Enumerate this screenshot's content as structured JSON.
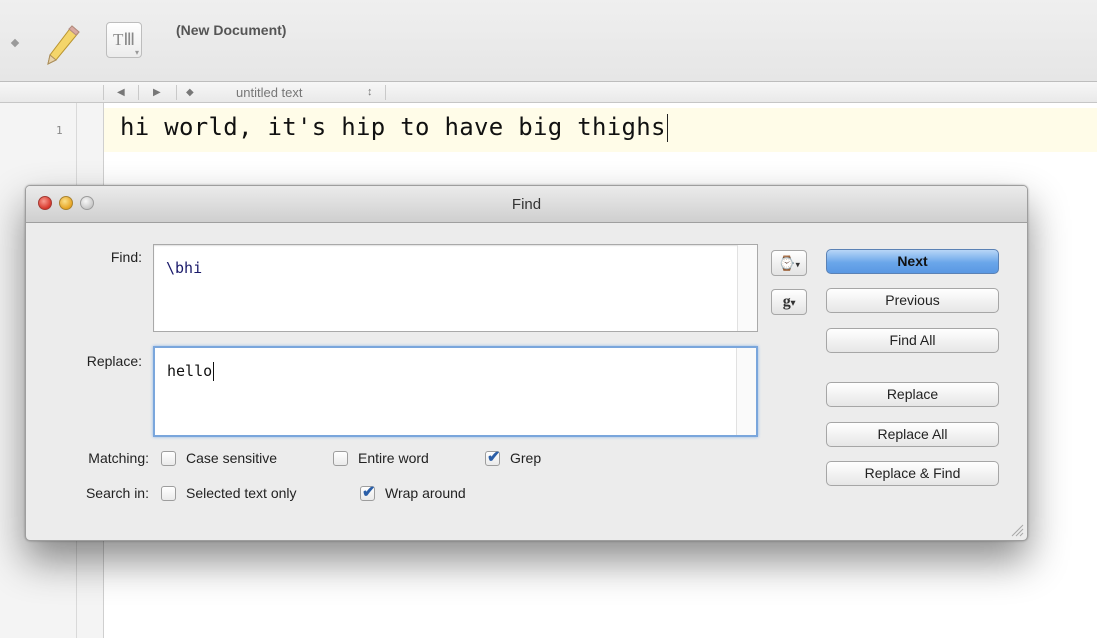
{
  "editor": {
    "document_title": "(New Document)",
    "text_button_glyph": "TⅢ",
    "nav": {
      "back_glyph": "◀",
      "forward_glyph": "▶",
      "marker_glyph": "◆",
      "file_name": "untitled text",
      "stepper_glyph": "↕"
    },
    "line_number": "1",
    "line_text": "hi world, it's hip to have big thighs"
  },
  "find_dialog": {
    "title": "Find",
    "find_label": "Find:",
    "find_value": "\\bhi",
    "replace_label": "Replace:",
    "replace_value": "hello",
    "history_glyph": "⌚",
    "grep_glyph": "g",
    "dropdown_glyph": "▾",
    "buttons": {
      "next": "Next",
      "previous": "Previous",
      "find_all": "Find All",
      "replace": "Replace",
      "replace_all": "Replace All",
      "replace_and_find": "Replace & Find"
    },
    "matching": {
      "label": "Matching:",
      "case_sensitive": {
        "label": "Case sensitive",
        "checked": false
      },
      "entire_word": {
        "label": "Entire word",
        "checked": false
      },
      "grep": {
        "label": "Grep",
        "checked": true
      }
    },
    "search_in": {
      "label": "Search in:",
      "selected_text_only": {
        "label": "Selected text only",
        "checked": false
      },
      "wrap_around": {
        "label": "Wrap around",
        "checked": true
      }
    }
  },
  "colors": {
    "primary_button": "#6aa6ea",
    "focus_ring": "#7aa6dc",
    "current_line": "#fffce8",
    "check_mark": "#2b5fa8"
  }
}
